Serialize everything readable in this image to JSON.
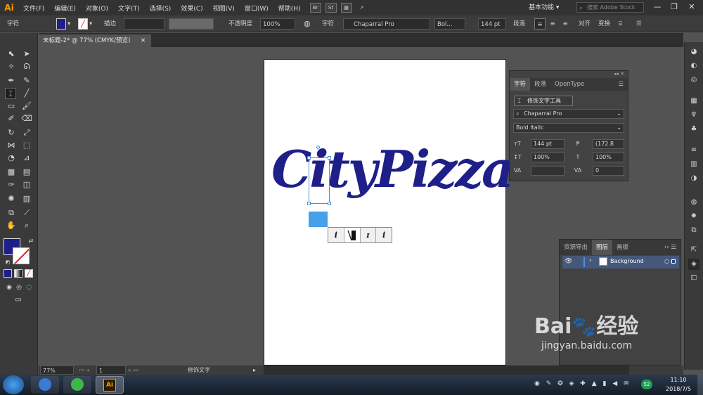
{
  "app": {
    "logo": "Ai",
    "menu": [
      "文件(F)",
      "编辑(E)",
      "对象(O)",
      "文字(T)",
      "选择(S)",
      "效果(C)",
      "视图(V)",
      "窗口(W)",
      "帮助(H)"
    ],
    "bridge_btn": "Br",
    "stock_btn": "St",
    "workspace": "基本功能",
    "stock_search_placeholder": "搜索 Adobe Stock",
    "win_minimize": "—",
    "win_restore": "❐",
    "win_close": "✕"
  },
  "control_bar": {
    "mode_label": "字符",
    "stroke_label": "描边",
    "opacity_label": "不透明度",
    "opacity_value": "100%",
    "char_label": "字符",
    "font_family": "Chaparral Pro",
    "font_style": "Bol...",
    "font_size": "144 pt",
    "paragraph_label": "段落",
    "align_label": "对齐",
    "transform_label": "变换"
  },
  "document": {
    "tab_title": "未标题-2* @ 77% (CMYK/预览)",
    "close": "✕"
  },
  "artwork": {
    "text": "CityPizza",
    "text_color": "#1f1f8a",
    "accent_square_color": "#47a1ea",
    "glyph_alternates": [
      "i",
      "i",
      "ɪ",
      "i"
    ]
  },
  "character_panel": {
    "tabs": [
      "字符",
      "段落",
      "OpenType"
    ],
    "touch_type_tool": "修饰文字工具",
    "font_family": "Chaparral Pro",
    "font_style": "Bold Italic",
    "font_size": "144 pt",
    "leading": "(172.8",
    "vertical_scale": "100%",
    "horizontal_scale": "100%",
    "kerning": "",
    "tracking": "0"
  },
  "layers_panel": {
    "tabs": [
      "资源导出",
      "图层",
      "画板"
    ],
    "layers": [
      {
        "name": "Background"
      }
    ]
  },
  "status_bar": {
    "zoom": "77%",
    "artboard_number": "1",
    "current_tool": "修饰文字"
  },
  "taskbar": {
    "time": "11:10",
    "date": "2018/7/5",
    "ai_label": "Ai",
    "badge": "52"
  },
  "watermark": {
    "brand": "Bai",
    "brand_cn": "经验",
    "url": "jingyan.baidu.com"
  }
}
